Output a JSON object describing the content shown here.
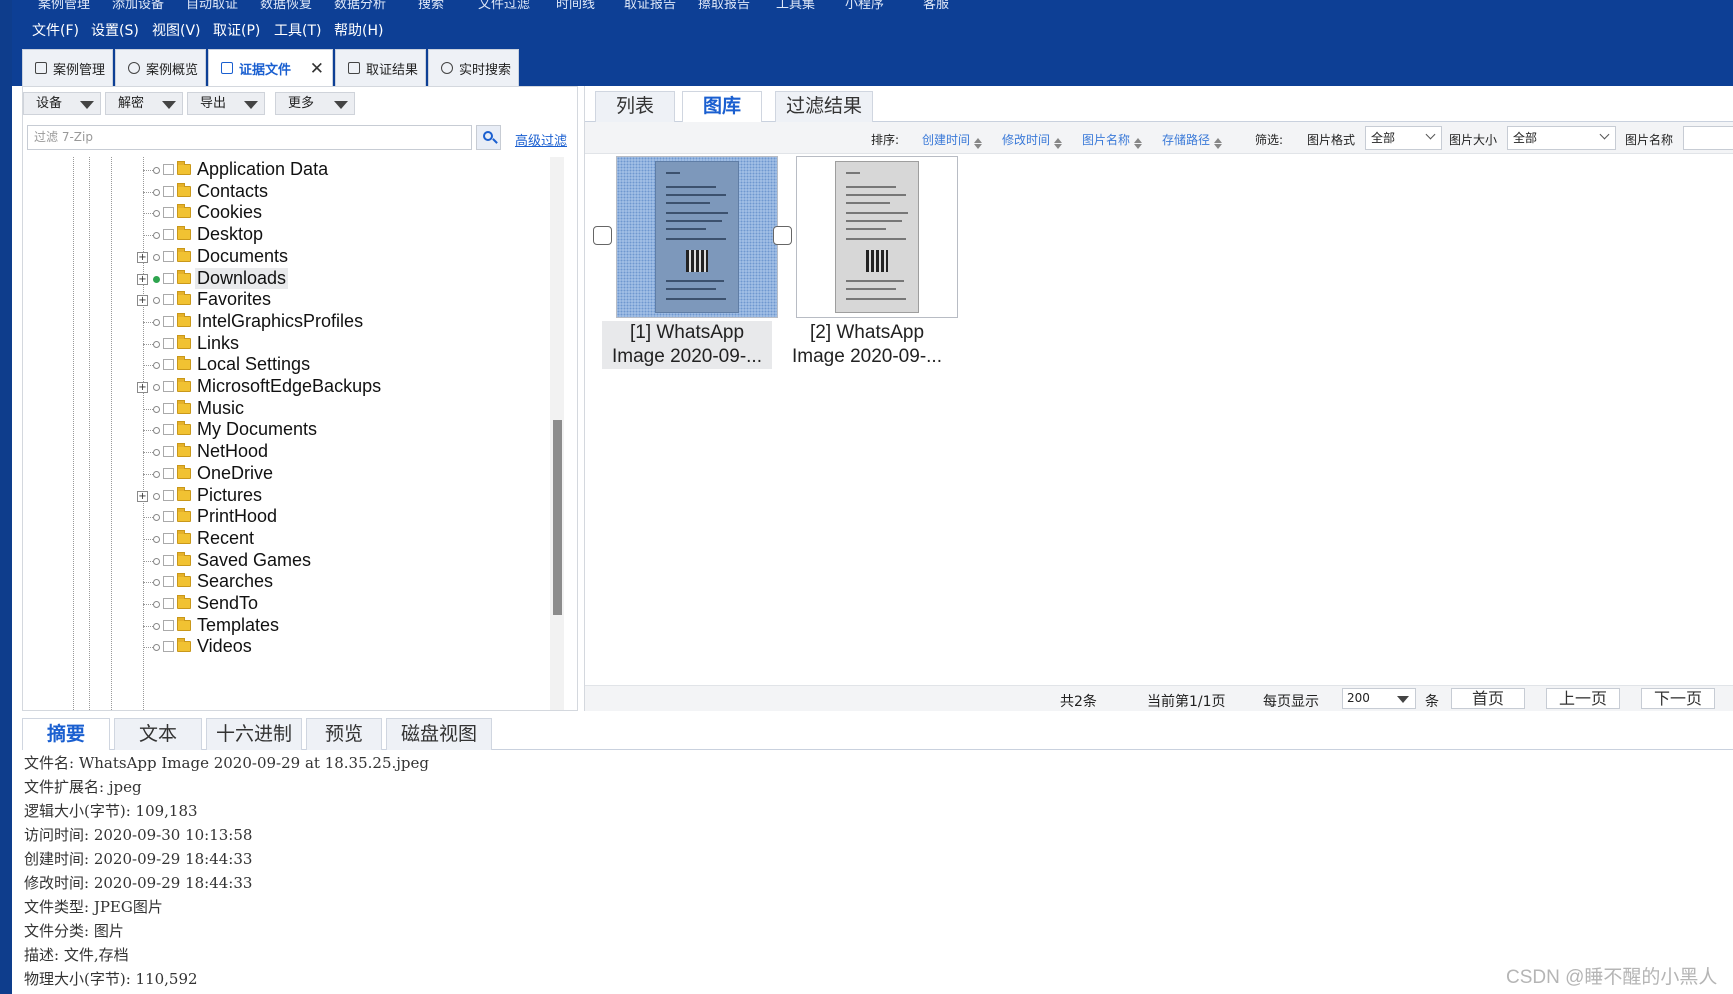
{
  "module_bar": {
    "items": [
      "案例管理",
      "添加设备",
      "自动取证",
      "数据恢复",
      "数据分析",
      "搜索",
      "文件过滤",
      "时间线",
      "取证报告",
      "擦取报告",
      "工具集",
      "小程序",
      "客服"
    ]
  },
  "menu": {
    "items": [
      "文件(F)",
      "设置(S)",
      "视图(V)",
      "取证(P)",
      "工具(T)",
      "帮助(H)"
    ]
  },
  "main_tabs": [
    {
      "label": "案例管理",
      "icon": "edit-icon"
    },
    {
      "label": "案例概览",
      "icon": "overview-icon"
    },
    {
      "label": "证据文件",
      "icon": "evidence-file-icon",
      "active": true
    },
    {
      "label": "取证结果",
      "icon": "result-icon"
    },
    {
      "label": "实时搜索",
      "icon": "search-icon"
    }
  ],
  "left_toolbar": {
    "dropdowns": [
      "设备",
      "解密",
      "导出",
      "更多"
    ]
  },
  "filter": {
    "placeholder": "过滤 7-Zip",
    "advanced_link": "高级过滤"
  },
  "tree": {
    "items": [
      {
        "label": "Application Data",
        "expandable": false
      },
      {
        "label": "Contacts",
        "expandable": false
      },
      {
        "label": "Cookies",
        "expandable": false
      },
      {
        "label": "Desktop",
        "expandable": false
      },
      {
        "label": "Documents",
        "expandable": true
      },
      {
        "label": "Downloads",
        "expandable": true,
        "selected": true
      },
      {
        "label": "Favorites",
        "expandable": true
      },
      {
        "label": "IntelGraphicsProfiles",
        "expandable": false
      },
      {
        "label": "Links",
        "expandable": false
      },
      {
        "label": "Local Settings",
        "expandable": false
      },
      {
        "label": "MicrosoftEdgeBackups",
        "expandable": true
      },
      {
        "label": "Music",
        "expandable": false
      },
      {
        "label": "My Documents",
        "expandable": false
      },
      {
        "label": "NetHood",
        "expandable": false
      },
      {
        "label": "OneDrive",
        "expandable": false
      },
      {
        "label": "Pictures",
        "expandable": true
      },
      {
        "label": "PrintHood",
        "expandable": false
      },
      {
        "label": "Recent",
        "expandable": false
      },
      {
        "label": "Saved Games",
        "expandable": false
      },
      {
        "label": "Searches",
        "expandable": false
      },
      {
        "label": "SendTo",
        "expandable": false
      },
      {
        "label": "Templates",
        "expandable": false
      },
      {
        "label": "Videos",
        "expandable": false
      }
    ]
  },
  "view_tabs": [
    {
      "label": "列表"
    },
    {
      "label": "图库",
      "active": true
    },
    {
      "label": "过滤结果"
    }
  ],
  "sort_bar": {
    "sort_label": "排序:",
    "sort_options": [
      "创建时间",
      "修改时间",
      "图片名称",
      "存储路径"
    ],
    "filter_label": "筛选:",
    "format_label": "图片格式",
    "format_value": "全部",
    "size_label": "图片大小",
    "size_value": "全部",
    "name_label": "图片名称"
  },
  "gallery": {
    "items": [
      {
        "caption_line1": "[1] WhatsApp",
        "caption_line2": "Image 2020-09-...",
        "selected": true
      },
      {
        "caption_line1": "[2] WhatsApp",
        "caption_line2": "Image 2020-09-...",
        "selected": false
      }
    ]
  },
  "pager": {
    "total": "共2条",
    "current_page": "当前第1/1页",
    "per_page_label": "每页显示",
    "per_page_value": "200",
    "unit": "条",
    "first": "首页",
    "prev": "上一页",
    "next": "下一页"
  },
  "bottom_tabs": [
    {
      "label": "摘要",
      "active": true
    },
    {
      "label": "文本"
    },
    {
      "label": "十六进制"
    },
    {
      "label": "预览"
    },
    {
      "label": "磁盘视图"
    }
  ],
  "summary": {
    "lines": [
      "文件名: WhatsApp Image 2020-09-29 at 18.35.25.jpeg",
      "文件扩展名: jpeg",
      "逻辑大小(字节): 109,183",
      "访问时间: 2020-09-30 10:13:58",
      "创建时间: 2020-09-29 18:44:33",
      "修改时间: 2020-09-29 18:44:33",
      "文件类型: JPEG图片",
      "文件分类: 图片",
      "描述: 文件,存档",
      "物理大小(字节): 110,592"
    ]
  },
  "watermark": "CSDN @睡不醒的小黑人",
  "colors": {
    "app_blue": "#0d3f95",
    "accent": "#1a5fd0",
    "selected_dot": "#2ea44f"
  }
}
